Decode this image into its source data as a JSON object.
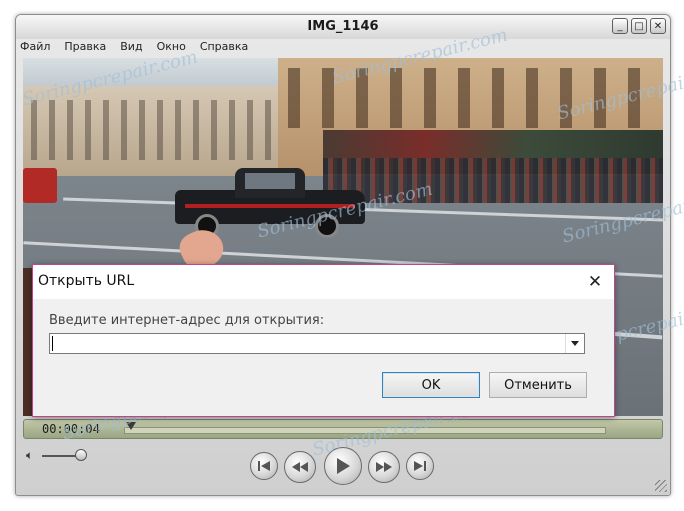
{
  "window": {
    "title": "IMG_1146",
    "buttons": [
      "_",
      "□",
      "✕"
    ]
  },
  "menu": [
    "Файл",
    "Правка",
    "Вид",
    "Окно",
    "Справка"
  ],
  "watermark": "Soringpcrepair.com",
  "player": {
    "time": "00:00:04"
  },
  "dialog": {
    "title": "Открыть URL",
    "close": "✕",
    "label": "Введите интернет-адрес для открытия:",
    "url_value": "",
    "ok": "OK",
    "cancel": "Отменить"
  }
}
